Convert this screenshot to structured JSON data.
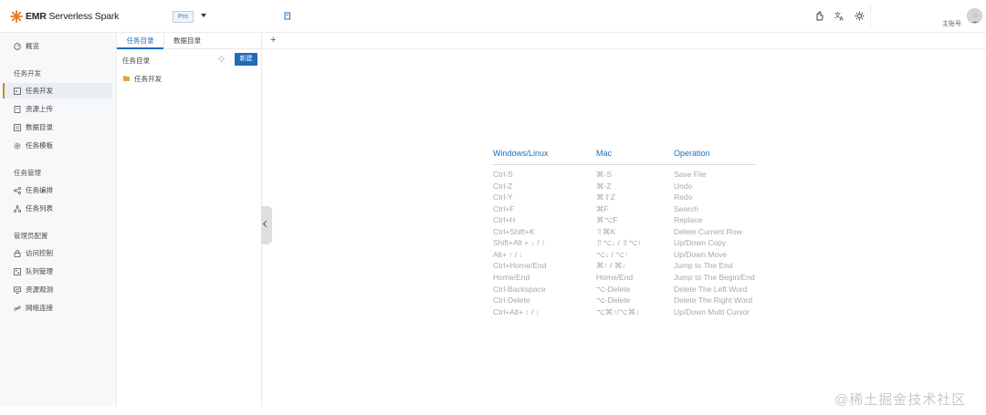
{
  "header": {
    "app_name_bold": "EMR",
    "app_name_rest": " Serverless Spark",
    "edition": "Pro",
    "username": "主账号"
  },
  "sidebar": {
    "overview": "概览",
    "groups": [
      {
        "title": "任务开发",
        "items": [
          "任务开发",
          "资源上传",
          "数据目录",
          "任务模板"
        ]
      },
      {
        "title": "任务管理",
        "items": [
          "任务编排",
          "任务列表"
        ]
      },
      {
        "title": "管理员配置",
        "items": [
          "访问控制",
          "队列管理",
          "资源观测",
          "网络连接"
        ]
      }
    ]
  },
  "panel": {
    "tabs": [
      "任务目录",
      "数据目录"
    ],
    "search_label": "任务目录",
    "new_button": "新建",
    "tree": [
      "任务开发"
    ]
  },
  "shortcuts": {
    "headers": [
      "Windows/Linux",
      "Mac",
      "Operation"
    ],
    "rows": [
      [
        "Ctrl-S",
        "⌘-S",
        "Save File"
      ],
      [
        "Ctrl-Z",
        "⌘-Z",
        "Undo"
      ],
      [
        "Ctrl-Y",
        "⌘⇧Z",
        "Redo"
      ],
      [
        "Ctrl+F",
        "⌘F",
        "Search"
      ],
      [
        "Ctrl+H",
        "⌘⌥F",
        "Replace"
      ],
      [
        "Ctrl+Shift+K",
        "⇧⌘K",
        "Delete Current Row"
      ],
      [
        "Shift+Alt + ↓ / ↑",
        "⇧⌥↓ / ⇧⌥↑",
        "Up/Down Copy"
      ],
      [
        "Alt+ ↑ / ↓",
        "⌥↓ / ⌥↑",
        "Up/Down Move"
      ],
      [
        "Ctrl+Home/End",
        "⌘↑ / ⌘↓",
        "Jump to The End"
      ],
      [
        "Home/End",
        "Home/End",
        "Jump to The Begin/End"
      ],
      [
        "Ctrl-Backspace",
        "⌥-Delete",
        "Delete The Left Word"
      ],
      [
        "Ctrl-Delete",
        "⌥-Delete",
        "Delete The Right Word"
      ],
      [
        "Ctrl+Alt+ ↑ / ↓",
        "⌥⌘↑/⌥⌘↓",
        "Up/Down Multi Cursor"
      ]
    ]
  },
  "watermark": "@稀土掘金技术社区",
  "colors": {
    "accent": "#1f6bb8",
    "active_bar": "#c88a3a",
    "logo": "#e8772e"
  }
}
